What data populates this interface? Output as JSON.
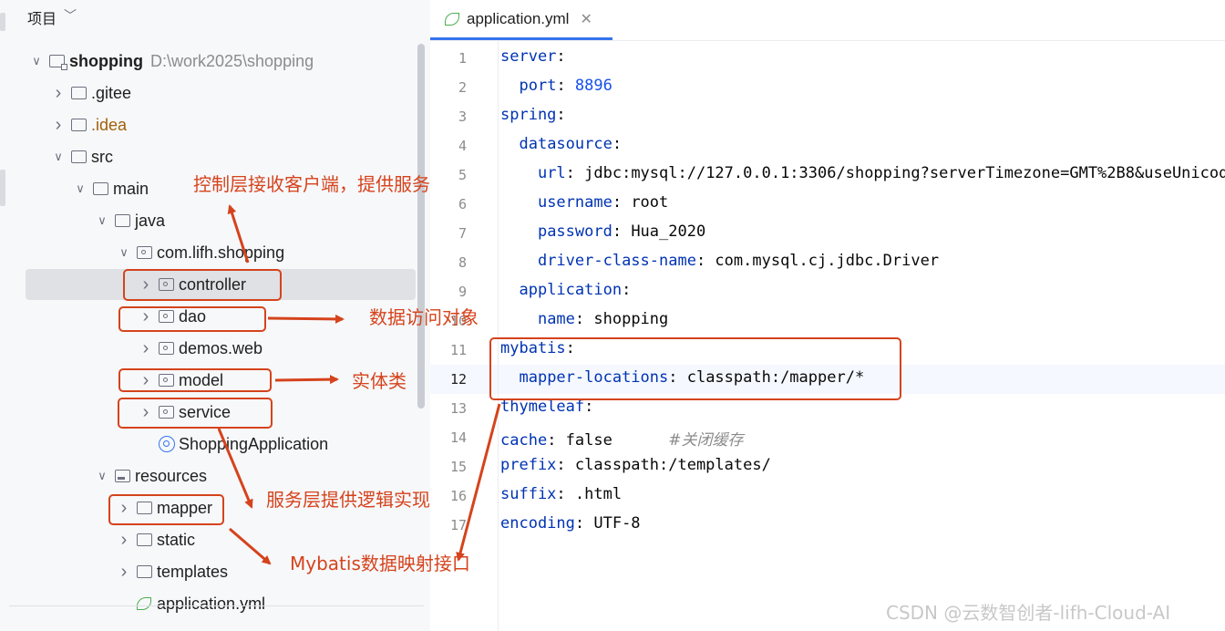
{
  "project_panel": {
    "title": "项目",
    "tree": [
      {
        "label": "shopping",
        "path": "D:\\work2025\\shopping",
        "icon": "project-folder-icon",
        "expanded": true,
        "indent": 0
      },
      {
        "label": ".gitee",
        "icon": "folder-icon",
        "expanded": false,
        "indent": 1
      },
      {
        "label": ".idea",
        "icon": "folder-icon",
        "expanded": false,
        "indent": 1
      },
      {
        "label": "src",
        "icon": "folder-icon",
        "expanded": true,
        "indent": 1
      },
      {
        "label": "main",
        "icon": "folder-icon",
        "expanded": true,
        "indent": 2
      },
      {
        "label": "java",
        "icon": "source-folder-icon",
        "expanded": true,
        "indent": 3
      },
      {
        "label": "com.lifh.shopping",
        "icon": "package-icon",
        "expanded": true,
        "indent": 4
      },
      {
        "label": "controller",
        "icon": "package-icon",
        "expanded": false,
        "indent": 5,
        "selected": true
      },
      {
        "label": "dao",
        "icon": "package-icon",
        "expanded": false,
        "indent": 5
      },
      {
        "label": "demos.web",
        "icon": "package-icon",
        "expanded": false,
        "indent": 5
      },
      {
        "label": "model",
        "icon": "package-icon",
        "expanded": false,
        "indent": 5
      },
      {
        "label": "service",
        "icon": "package-icon",
        "expanded": false,
        "indent": 5
      },
      {
        "label": "ShoppingApplication",
        "icon": "spring-class-icon",
        "indent": 5
      },
      {
        "label": "resources",
        "icon": "resources-folder-icon",
        "expanded": true,
        "indent": 3
      },
      {
        "label": "mapper",
        "icon": "folder-icon",
        "expanded": false,
        "indent": 4
      },
      {
        "label": "static",
        "icon": "folder-icon",
        "expanded": false,
        "indent": 4
      },
      {
        "label": "templates",
        "icon": "folder-icon",
        "expanded": false,
        "indent": 4
      },
      {
        "label": "application.yml",
        "icon": "yaml-leaf-icon",
        "indent": 4
      }
    ]
  },
  "editor": {
    "tab_label": "application.yml",
    "tab_icon": "yaml-leaf-icon",
    "current_line": 12,
    "lines": [
      {
        "n": "1",
        "tokens": [
          [
            "k",
            "server"
          ],
          [
            "p",
            ":"
          ]
        ]
      },
      {
        "n": "2",
        "tokens": [
          [
            "p",
            "  "
          ],
          [
            "k",
            "port"
          ],
          [
            "p",
            ": "
          ],
          [
            "v",
            "8896"
          ]
        ]
      },
      {
        "n": "3",
        "tokens": [
          [
            "k",
            "spring"
          ],
          [
            "p",
            ":"
          ]
        ]
      },
      {
        "n": "4",
        "tokens": [
          [
            "p",
            "  "
          ],
          [
            "k",
            "datasource"
          ],
          [
            "p",
            ":"
          ]
        ]
      },
      {
        "n": "5",
        "tokens": [
          [
            "p",
            "    "
          ],
          [
            "k",
            "url"
          ],
          [
            "p",
            ": jdbc:mysql://127.0.0.1:3306/shopping?serverTimezone=GMT%2B8&useUnicod"
          ]
        ]
      },
      {
        "n": "6",
        "tokens": [
          [
            "p",
            "    "
          ],
          [
            "k",
            "username"
          ],
          [
            "p",
            ": root"
          ]
        ]
      },
      {
        "n": "7",
        "tokens": [
          [
            "p",
            "    "
          ],
          [
            "k",
            "password"
          ],
          [
            "p",
            ": Hua_2020"
          ]
        ]
      },
      {
        "n": "8",
        "tokens": [
          [
            "p",
            "    "
          ],
          [
            "k",
            "driver-class-name"
          ],
          [
            "p",
            ": com.mysql.cj.jdbc.Driver"
          ]
        ]
      },
      {
        "n": "9",
        "tokens": [
          [
            "p",
            "  "
          ],
          [
            "k",
            "application"
          ],
          [
            "p",
            ":"
          ]
        ]
      },
      {
        "n": "10",
        "tokens": [
          [
            "p",
            "    "
          ],
          [
            "k",
            "name"
          ],
          [
            "p",
            ": shopping"
          ]
        ]
      },
      {
        "n": "11",
        "tokens": [
          [
            "k",
            "mybatis"
          ],
          [
            "p",
            ":"
          ]
        ]
      },
      {
        "n": "12",
        "tokens": [
          [
            "p",
            "  "
          ],
          [
            "k",
            "mapper-locations"
          ],
          [
            "p",
            ": classpath:/mapper/*"
          ]
        ]
      },
      {
        "n": "13",
        "tokens": [
          [
            "k",
            "thymeleaf"
          ],
          [
            "p",
            ":"
          ]
        ]
      },
      {
        "n": "14",
        "tokens": [
          [
            "k",
            "cache"
          ],
          [
            "p",
            ": false      "
          ],
          [
            "c",
            "#关闭缓存"
          ]
        ]
      },
      {
        "n": "15",
        "tokens": [
          [
            "k",
            "prefix"
          ],
          [
            "p",
            ": classpath:/templates/"
          ]
        ]
      },
      {
        "n": "16",
        "tokens": [
          [
            "k",
            "suffix"
          ],
          [
            "p",
            ": .html"
          ]
        ]
      },
      {
        "n": "17",
        "tokens": [
          [
            "k",
            "encoding"
          ],
          [
            "p",
            ": UTF-8"
          ]
        ]
      }
    ]
  },
  "annotations": {
    "controller": "控制层接收客户端，提供服务",
    "dao": "数据访问对象",
    "model": "实体类",
    "service": "服务层提供逻辑实现",
    "mapper": "Mybatis数据映射接口"
  },
  "annotation_color": "#d5431c",
  "watermark": "CSDN @云数智创者-lifh-Cloud-AI"
}
